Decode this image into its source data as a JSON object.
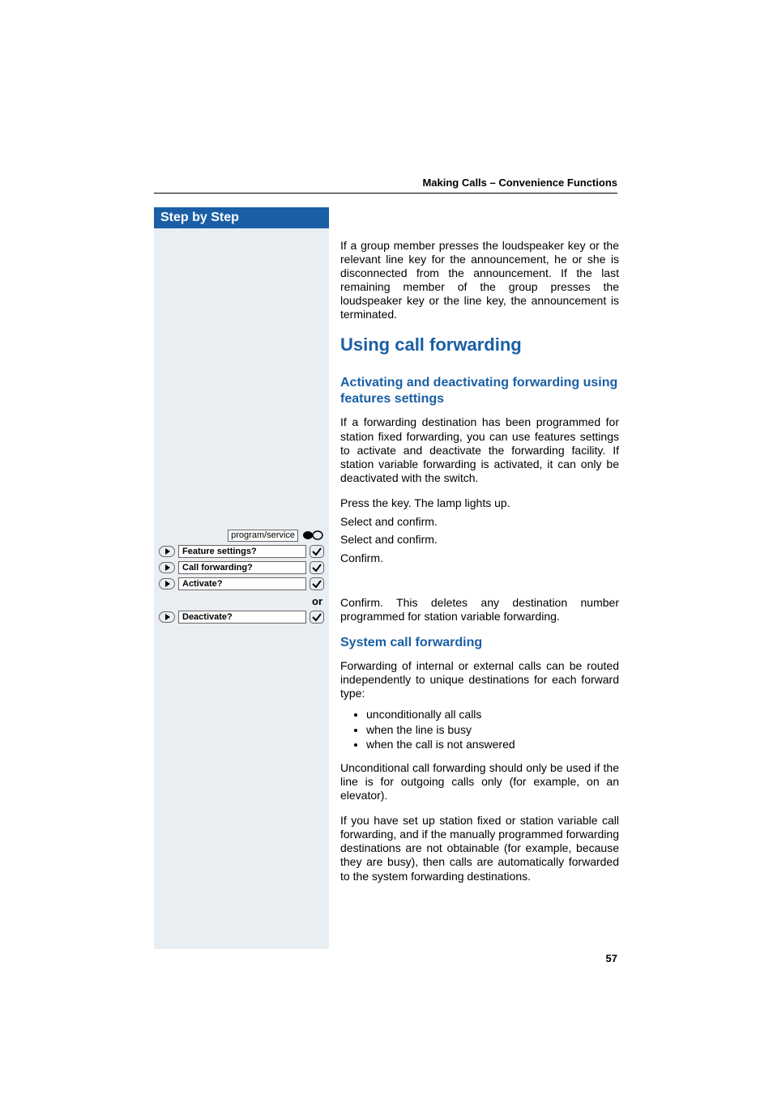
{
  "runningHeader": "Making Calls – Convenience Functions",
  "sidebar": {
    "title": "Step by Step",
    "programServiceLabel": "program/service",
    "rows": {
      "feature": "Feature settings?",
      "callFwd": "Call forwarding?",
      "activate": "Activate?",
      "or": "or",
      "deactivate": "Deactivate?"
    }
  },
  "main": {
    "introPara": "If a group member presses the loudspeaker key or the relevant line key for the announcement, he or she is disconnected from the announcement. If the last remaining member of the group presses the loudspeaker key or the line key, the announcement is terminated.",
    "h1": "Using call forwarding",
    "h2a": "Activating and deactivating forwarding using features settings",
    "paraA": "If a forwarding destination has been programmed for station fixed forwarding, you can use features settings to activate and deactivate the forwarding facility. If station variable forwarding is activated, it can only be deactivated with the switch.",
    "pressKey": "Press the key. The lamp lights up.",
    "selectConfirm1": "Select and confirm.",
    "selectConfirm2": "Select and confirm.",
    "confirm": "Confirm.",
    "confirmDelete": "Confirm. This deletes any destination number programmed for station variable forwarding.",
    "h2b": "System call forwarding",
    "paraB1": "Forwarding of internal or external calls can be routed independently to unique destinations for each forward type:",
    "bullets": [
      "unconditionally all calls",
      "when the line is busy",
      "when the call is not answered"
    ],
    "paraB2": "Unconditional call forwarding should only be used if the line is for outgoing calls only (for example, on an elevator).",
    "paraB3": "If you have set up station fixed or station variable call forwarding, and if the manually programmed forwarding destinations are not obtainable (for example, because they are busy), then calls are automatically forwarded to the system forwarding destinations."
  },
  "pageNumber": "57"
}
